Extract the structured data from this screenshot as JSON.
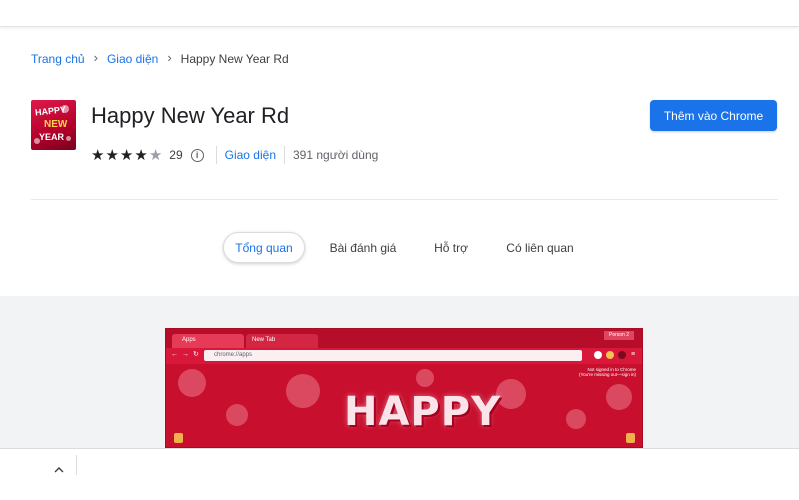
{
  "breadcrumb": {
    "home": "Trang chủ",
    "category": "Giao diện",
    "current": "Happy New Year Rd"
  },
  "extension": {
    "title": "Happy New Year Rd",
    "rating": 4,
    "rating_max": 5,
    "rating_count": "29",
    "category_link": "Giao diện",
    "users": "391 người dùng"
  },
  "add_button_label": "Thêm vào Chrome",
  "tabs": [
    {
      "label": "Tổng quan",
      "active": true
    },
    {
      "label": "Bài đánh giá",
      "active": false
    },
    {
      "label": "Hỗ trợ",
      "active": false
    },
    {
      "label": "Có liên quan",
      "active": false
    }
  ],
  "logo": {
    "word1": "HAPPY",
    "word2": "NEW",
    "word3": "YEAR"
  },
  "screenshot": {
    "tab1": "Apps",
    "tab2": "New Tab",
    "omnibox": "chrome://apps",
    "person": "Person 2",
    "note_line1": "Not signed in to Chrome",
    "note_line2": "(You're missing out—sign in)",
    "headline": "HAPPY"
  },
  "colors": {
    "accent": "#1a73e8",
    "theme_red": "#c8102e"
  },
  "icons": {
    "breadcrumb_separator": "chevron-right-icon",
    "info": "info-icon",
    "collapse": "chevron-up-icon"
  }
}
